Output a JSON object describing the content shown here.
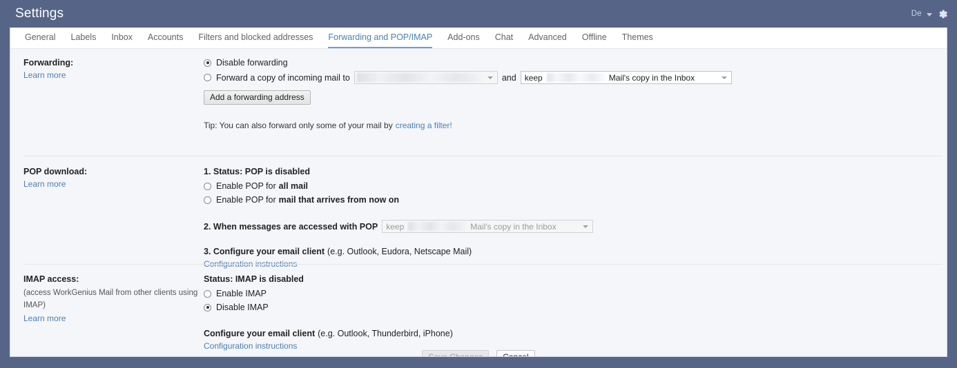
{
  "window": {
    "title": "Settings",
    "lang_label": "De",
    "gear_icon": "gear-icon",
    "caret_icon": "chevron-down-icon",
    "header_bg": "#566587",
    "accent": "#4a7fb5"
  },
  "tabs": [
    {
      "label": "General",
      "active": false
    },
    {
      "label": "Labels",
      "active": false
    },
    {
      "label": "Inbox",
      "active": false
    },
    {
      "label": "Accounts",
      "active": false
    },
    {
      "label": "Filters and blocked addresses",
      "active": false
    },
    {
      "label": "Forwarding and POP/IMAP",
      "active": true
    },
    {
      "label": "Add-ons",
      "active": false
    },
    {
      "label": "Chat",
      "active": false
    },
    {
      "label": "Advanced",
      "active": false
    },
    {
      "label": "Offline",
      "active": false
    },
    {
      "label": "Themes",
      "active": false
    }
  ],
  "forwarding": {
    "heading": "Forwarding:",
    "learn_more": "Learn more",
    "option_disable": "Disable forwarding",
    "option_forward_prefix": "Forward a copy of incoming mail to",
    "address_select_value": "",
    "conjunction": "and",
    "action_select_prefix": "keep",
    "action_select_suffix": "Mail's copy in the Inbox",
    "add_address_button": "Add a forwarding address",
    "tip_prefix": "Tip: You can also forward only some of your mail by",
    "tip_link": "creating a filter!"
  },
  "pop": {
    "heading": "POP download:",
    "learn_more": "Learn more",
    "status": "1. Status: POP is disabled",
    "enable_all_prefix": "Enable POP for",
    "enable_all_bold": "all mail",
    "enable_now_prefix": "Enable POP for",
    "enable_now_bold": "mail that arrives from now on",
    "step2_label": "2. When messages are accessed with POP",
    "step2_select_prefix": "keep",
    "step2_select_suffix": "Mail's copy in the Inbox",
    "step3_bold": "3. Configure your email client",
    "step3_rest": "(e.g. Outlook, Eudora, Netscape Mail)",
    "step3_link": "Configuration instructions"
  },
  "imap": {
    "heading": "IMAP access:",
    "sub": "(access WorkGenius Mail from other clients using IMAP)",
    "learn_more": "Learn more",
    "status": "Status: IMAP is disabled",
    "option_enable": "Enable IMAP",
    "option_disable": "Disable IMAP",
    "configure_bold": "Configure your email client",
    "configure_rest": "(e.g. Outlook, Thunderbird, iPhone)",
    "configure_link": "Configuration instructions"
  },
  "footer": {
    "save_label": "Save Changes",
    "cancel_label": "Cancel"
  }
}
